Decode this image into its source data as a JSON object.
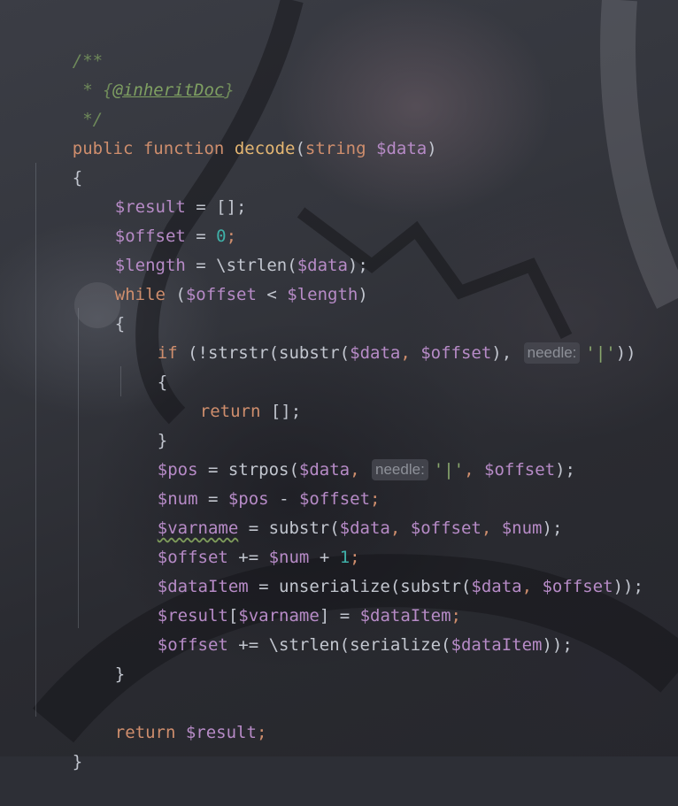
{
  "editor": {
    "lines": {
      "l1": {
        "comment": "/**"
      },
      "l2": {
        "star": " * {",
        "doctag": "@inheritDoc",
        "close": "}"
      },
      "l3": {
        "comment": " */"
      },
      "l4": {
        "kw_public": "public",
        "kw_function": "function",
        "fn": "decode",
        "paren_open": "(",
        "type": "string",
        "var": "$data",
        "paren_close": ")"
      },
      "l5": {
        "brace": "{"
      },
      "l6": {
        "var": "$result",
        "op": " = [];"
      },
      "l7": {
        "var": "$offset",
        "op": " = ",
        "num": "0",
        "end": ";"
      },
      "l8": {
        "var": "$length",
        "op": " = \\strlen(",
        "var2": "$data",
        "end": ");"
      },
      "l9": {
        "kw": "while",
        "open": " (",
        "var": "$offset",
        "op": " < ",
        "var2": "$length",
        "close": ")"
      },
      "l10": {
        "brace": "{"
      },
      "l11": {
        "kw": "if",
        "mid": " (!strstr(substr(",
        "var": "$data",
        "comma": ", ",
        "var2": "$offset",
        "mid2": "), ",
        "hint": "needle:",
        "str": "'|'",
        "end": "))"
      },
      "l12": {
        "brace": "{"
      },
      "l13": {
        "kw": "return",
        "end": " [];"
      },
      "l14": {
        "brace": "}"
      },
      "l15": {
        "var": "$pos",
        "mid": " = strpos(",
        "var2": "$data",
        "comma": ", ",
        "hint": "needle:",
        "str": "'|'",
        "comma2": ", ",
        "var3": "$offset",
        "end": ");"
      },
      "l16": {
        "var": "$num",
        "mid": " = ",
        "var2": "$pos",
        "op": " - ",
        "var3": "$offset",
        "end": ";"
      },
      "l17": {
        "var": "$varname",
        "mid": " = substr(",
        "var2": "$data",
        "comma": ", ",
        "var3": "$offset",
        "comma2": ", ",
        "var4": "$num",
        "end": ");"
      },
      "l18": {
        "var": "$offset",
        "op": " += ",
        "var2": "$num",
        "op2": " + ",
        "num": "1",
        "end": ";"
      },
      "l19": {
        "var": "$dataItem",
        "mid": " = unserialize(substr(",
        "var2": "$data",
        "comma": ", ",
        "var3": "$offset",
        "end": "));"
      },
      "l20": {
        "var": "$result",
        "open": "[",
        "var2": "$varname",
        "mid": "] = ",
        "var3": "$dataItem",
        "end": ";"
      },
      "l21": {
        "var": "$offset",
        "mid": " += \\strlen(serialize(",
        "var2": "$dataItem",
        "end": "));"
      },
      "l22": {
        "brace": "}"
      },
      "l24": {
        "kw": "return",
        "sp": " ",
        "var": "$result",
        "end": ";"
      },
      "l25": {
        "brace": "}"
      }
    },
    "colors": {
      "keyword": "#cf8e6d",
      "function": "#e4b672",
      "variable": "#b78bc7",
      "number": "#3fb0a8",
      "string": "#8aa86d",
      "comment": "#6f8a5a",
      "plain": "#c2c6cf"
    }
  }
}
